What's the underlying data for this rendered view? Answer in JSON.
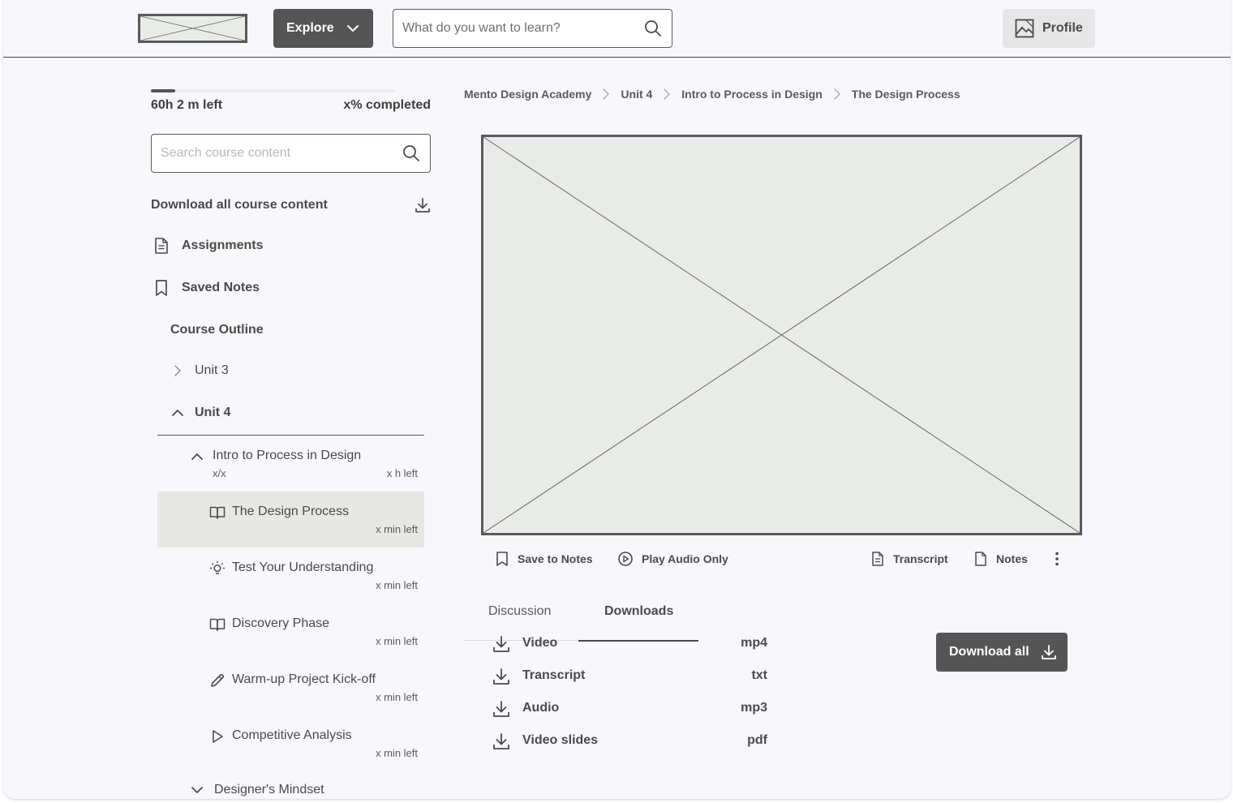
{
  "header": {
    "explore_label": "Explore",
    "search_placeholder": "What do you want to learn?",
    "profile_label": "Profile"
  },
  "sidebar": {
    "progress_fraction": 0.1,
    "time_left": "60h 2 m left",
    "completed": "x% completed",
    "search_placeholder": "Search course content",
    "download_all_label": "Download all course content",
    "assignments_label": "Assignments",
    "saved_notes_label": "Saved Notes",
    "course_outline_label": "Course Outline",
    "unit3_label": "Unit 3",
    "unit4_label": "Unit 4",
    "section": {
      "title": "Intro to Process in Design",
      "count": "x/x",
      "time_left": "x h left"
    },
    "lessons": [
      {
        "title": "The Design Process",
        "time_left": "x min left",
        "icon": "book-icon"
      },
      {
        "title": "Test Your Understanding",
        "time_left": "x min left",
        "icon": "lightbulb-icon"
      },
      {
        "title": "Discovery Phase",
        "time_left": "x min left",
        "icon": "book-icon"
      },
      {
        "title": "Warm-up Project Kick-off",
        "time_left": "x min left",
        "icon": "pencil-icon"
      },
      {
        "title": "Competitive Analysis",
        "time_left": "x min left",
        "icon": "play-icon"
      }
    ],
    "next_section_label": "Designer's Mindset"
  },
  "breadcrumb": [
    "Mento Design Academy",
    "Unit 4",
    "Intro to Process in Design",
    "The Design Process"
  ],
  "video_toolbar": {
    "save_to_notes": "Save to Notes",
    "play_audio_only": "Play Audio Only",
    "transcript": "Transcript",
    "notes": "Notes"
  },
  "tabs": [
    "Discussion",
    "Downloads"
  ],
  "active_tab": "Downloads",
  "downloads": [
    {
      "name": "Video",
      "type": "mp4"
    },
    {
      "name": "Transcript",
      "type": "txt"
    },
    {
      "name": "Audio",
      "type": "mp3"
    },
    {
      "name": "Video slides",
      "type": "pdf"
    }
  ],
  "download_all_label": "Download all",
  "colors": {
    "dark_button": "#555555",
    "background": "#f8f8fc",
    "placeholder_fill": "#e9ebe8",
    "active_lesson": "#e7e8e6"
  }
}
